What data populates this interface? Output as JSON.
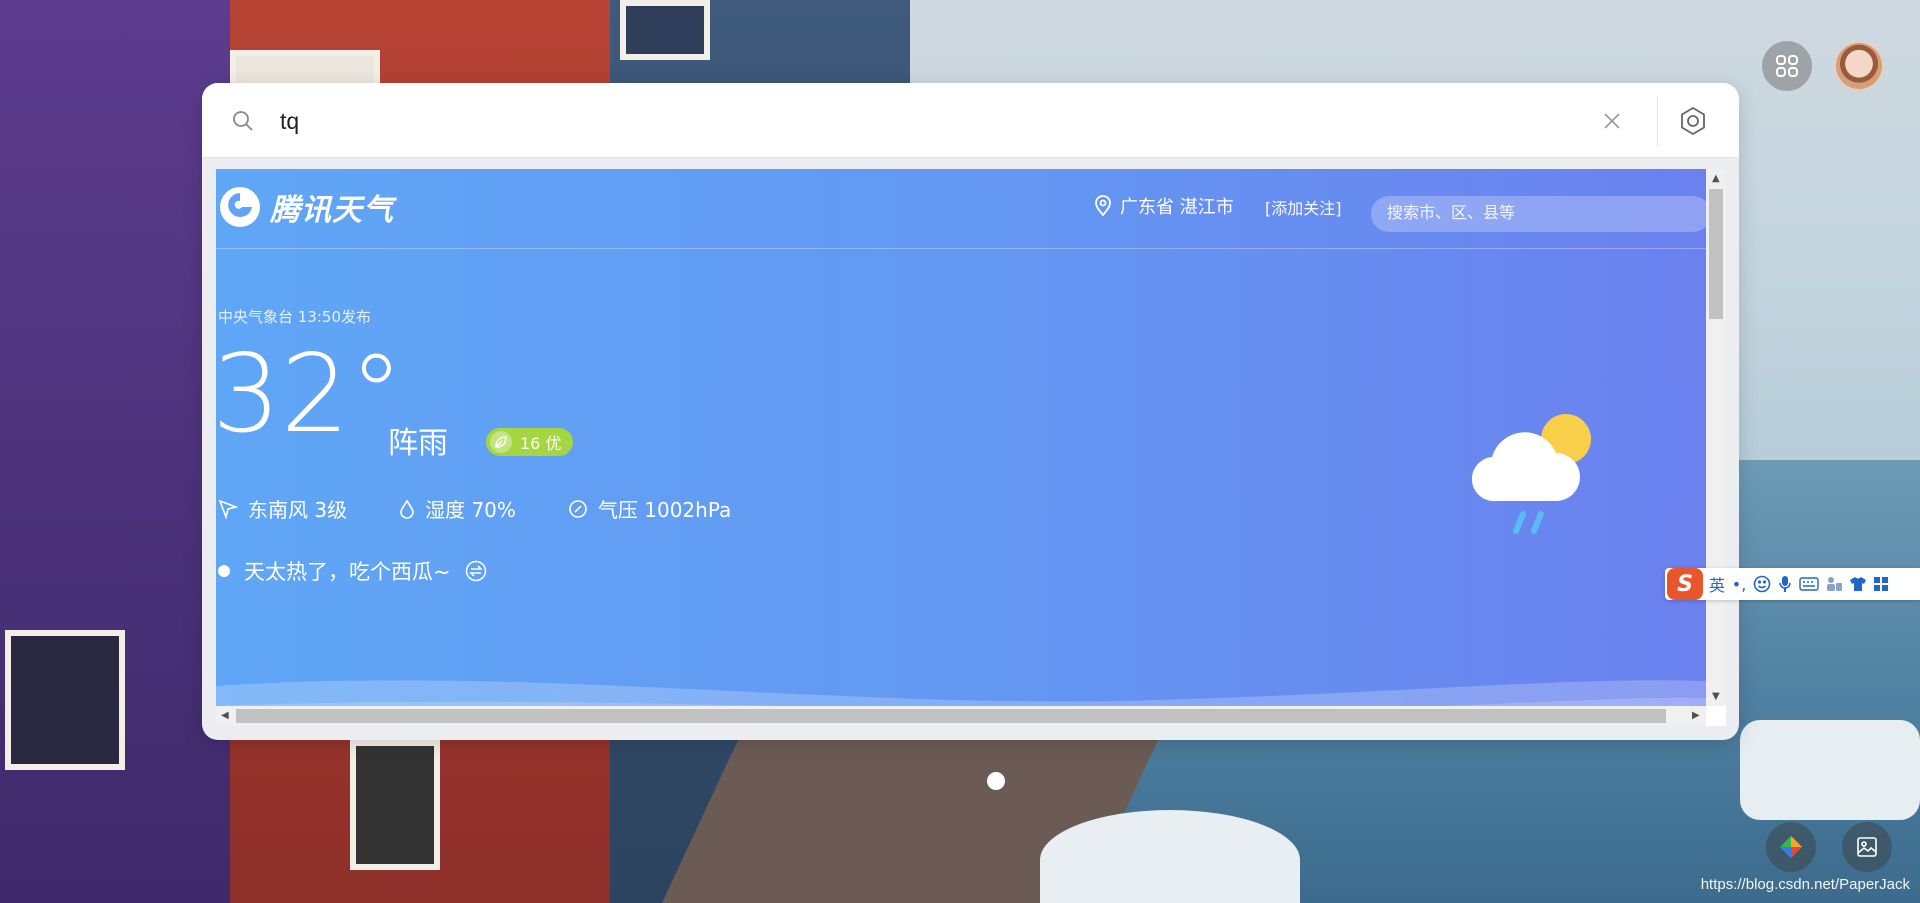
{
  "search": {
    "value": "tq"
  },
  "weather": {
    "brand": "腾讯天气",
    "location": "广东省 湛江市",
    "follow_label": "[添加关注]",
    "search_placeholder": "搜索市、区、县等",
    "publish_info": "中央气象台 13:50发布",
    "temperature": "32°",
    "condition": "阵雨",
    "aqi": "16 优",
    "wind": "东南风 3级",
    "humidity": "湿度 70%",
    "pressure": "气压 1002hPa",
    "tip": "天太热了，吃个西瓜~"
  },
  "ime": {
    "logo": "S",
    "mode": "英",
    "punct": "•,"
  },
  "footer": {
    "watermark": "https://blog.csdn.net/PaperJack"
  },
  "colors": {
    "weather_gradient_start": "#60a6f6",
    "weather_gradient_end": "#6b81ef",
    "aqi_good": "#a5d63f",
    "sun": "#f9cf4a",
    "rain": "#5bbcf5"
  },
  "icons": [
    "search-icon",
    "close-icon",
    "search-engine-icon",
    "apps-grid-icon",
    "location-pin-icon",
    "wind-icon",
    "humidity-drop-icon",
    "pressure-compass-icon",
    "refresh-swap-icon",
    "leaf-icon",
    "image-icon",
    "color-picker-icon"
  ]
}
